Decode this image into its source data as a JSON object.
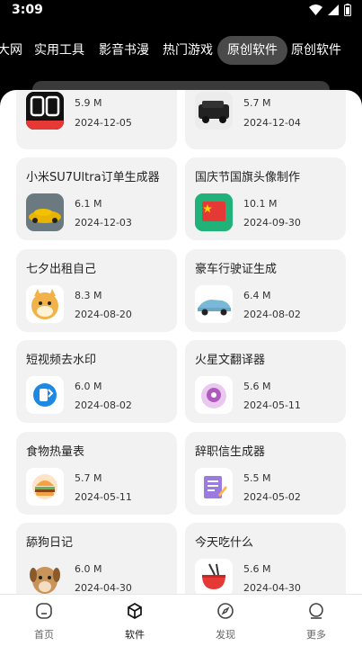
{
  "status": {
    "time": "3:09"
  },
  "tabs": [
    {
      "label": "大网"
    },
    {
      "label": "实用工具"
    },
    {
      "label": "影音书漫"
    },
    {
      "label": "热门游戏"
    },
    {
      "label": "原创软件"
    },
    {
      "label": "原创软件"
    }
  ],
  "cards": [
    {
      "title": "",
      "size": "5.9 M",
      "date": "2024-12-05",
      "icon": "dewu-icon"
    },
    {
      "title": "",
      "size": "5.7 M",
      "date": "2024-12-04",
      "icon": "car-mercedes-icon"
    },
    {
      "title": "小米SU7Ultra订单生成器",
      "size": "6.1 M",
      "date": "2024-12-03",
      "icon": "su7-car-icon"
    },
    {
      "title": "国庆节国旗头像制作",
      "size": "10.1 M",
      "date": "2024-09-30",
      "icon": "china-flag-icon"
    },
    {
      "title": "七夕出租自己",
      "size": "8.3 M",
      "date": "2024-08-20",
      "icon": "doge-icon"
    },
    {
      "title": "豪车行驶证生成",
      "size": "6.4 M",
      "date": "2024-08-02",
      "icon": "sports-car-icon"
    },
    {
      "title": "短视频去水印",
      "size": "6.0 M",
      "date": "2024-08-02",
      "icon": "video-watermark-icon"
    },
    {
      "title": "火星文翻译器",
      "size": "5.6 M",
      "date": "2024-05-11",
      "icon": "alien-icon"
    },
    {
      "title": "食物热量表",
      "size": "5.7 M",
      "date": "2024-05-11",
      "icon": "burger-icon"
    },
    {
      "title": "辞职信生成器",
      "size": "5.5 M",
      "date": "2024-05-02",
      "icon": "letter-icon"
    },
    {
      "title": "舔狗日记",
      "size": "6.0 M",
      "date": "2024-04-30",
      "icon": "dog-icon"
    },
    {
      "title": "今天吃什么",
      "size": "5.6 M",
      "date": "2024-04-30",
      "icon": "noodle-bowl-icon"
    }
  ],
  "nav": [
    {
      "label": "首页",
      "icon": "home-icon"
    },
    {
      "label": "软件",
      "icon": "cube-icon"
    },
    {
      "label": "发现",
      "icon": "compass-icon"
    },
    {
      "label": "更多",
      "icon": "more-icon"
    }
  ]
}
